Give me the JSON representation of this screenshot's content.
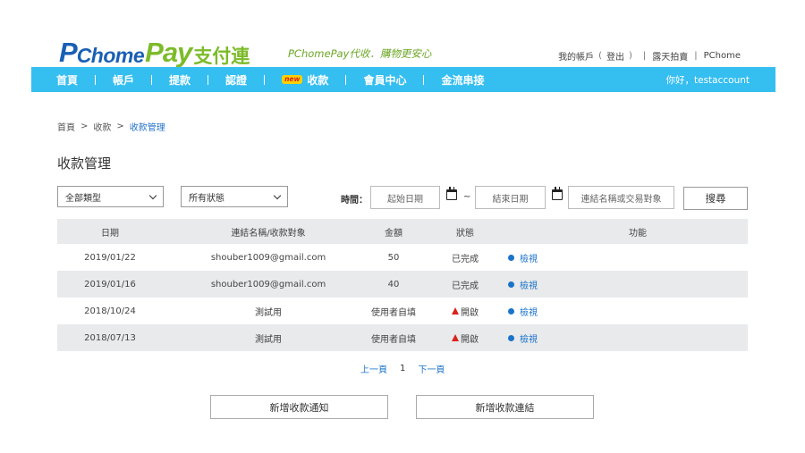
{
  "header": {
    "logo": {
      "p": "P",
      "chome": "Chome",
      "pay": "Pay",
      "cn": "支付連"
    },
    "slogan": "PChomePay代收．購物更安心",
    "links": {
      "account": "我的帳戶",
      "logout": "登出",
      "auction": "露天拍賣",
      "pchome": "PChome"
    }
  },
  "nav": {
    "items": [
      {
        "label": "首頁"
      },
      {
        "label": "帳戶"
      },
      {
        "label": "提款"
      },
      {
        "label": "認證"
      },
      {
        "label": "收款",
        "badge": "new"
      },
      {
        "label": "會員中心"
      },
      {
        "label": "金流串接"
      }
    ],
    "greeting": "你好，testaccount"
  },
  "breadcrumb": {
    "home": "首頁",
    "collect": "收款",
    "current": "收款管理"
  },
  "page_title": "收款管理",
  "filters": {
    "type_select": "全部類型",
    "status_select": "所有狀態",
    "time_label": "時間：",
    "start_placeholder": "起始日期",
    "tilde": "~",
    "end_placeholder": "結束日期",
    "keyword_placeholder": "連結名稱或交易對象",
    "search_label": "搜尋"
  },
  "table": {
    "headers": {
      "date": "日期",
      "name": "連結名稱/收款對象",
      "amount": "金額",
      "status": "狀態",
      "actions": "功能"
    },
    "rows": [
      {
        "date": "2019/01/22",
        "name": "shouber1009@gmail.com",
        "amount": "50",
        "status": "已完成",
        "warn": false,
        "action": "檢視"
      },
      {
        "date": "2019/01/16",
        "name": "shouber1009@gmail.com",
        "amount": "40",
        "status": "已完成",
        "warn": false,
        "action": "檢視"
      },
      {
        "date": "2018/10/24",
        "name": "測試用",
        "amount": "使用者自填",
        "status": "開啟",
        "warn": true,
        "action": "檢視"
      },
      {
        "date": "2018/07/13",
        "name": "測試用",
        "amount": "使用者自填",
        "status": "開啟",
        "warn": true,
        "action": "檢視"
      }
    ]
  },
  "pagination": {
    "prev": "上一頁",
    "current": "1",
    "next": "下一頁"
  },
  "buttons": {
    "new_notice": "新增收款通知",
    "new_link": "新增收款連結"
  },
  "colors": {
    "nav_bg": "#35bef0",
    "logo_blue": "#1a5fb4",
    "logo_green": "#7cbb2a",
    "link_blue": "#1a73c9",
    "warn_red": "#d9231d"
  }
}
